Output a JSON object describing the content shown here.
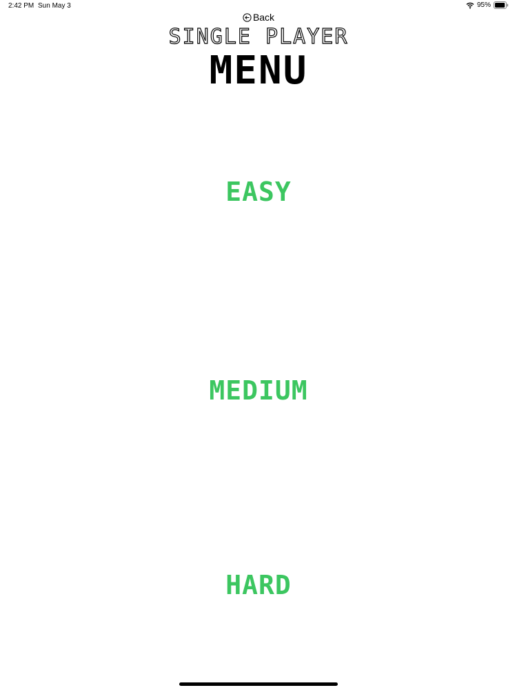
{
  "status_bar": {
    "time": "2:42 PM",
    "date": "Sun May 3",
    "battery_percent": "95%",
    "battery_level": 0.95
  },
  "nav": {
    "back_label": "Back"
  },
  "header": {
    "title_line1": "SINGLE PLAYER",
    "title_line2": "MENU"
  },
  "difficulties": {
    "easy": "EASY",
    "medium": "MEDIUM",
    "hard": "HARD"
  },
  "colors": {
    "accent_green": "#3cc660",
    "text": "#000000",
    "background": "#ffffff"
  },
  "icons": {
    "back": "circle-arrow-left-icon",
    "wifi": "wifi-icon",
    "battery": "battery-icon"
  }
}
